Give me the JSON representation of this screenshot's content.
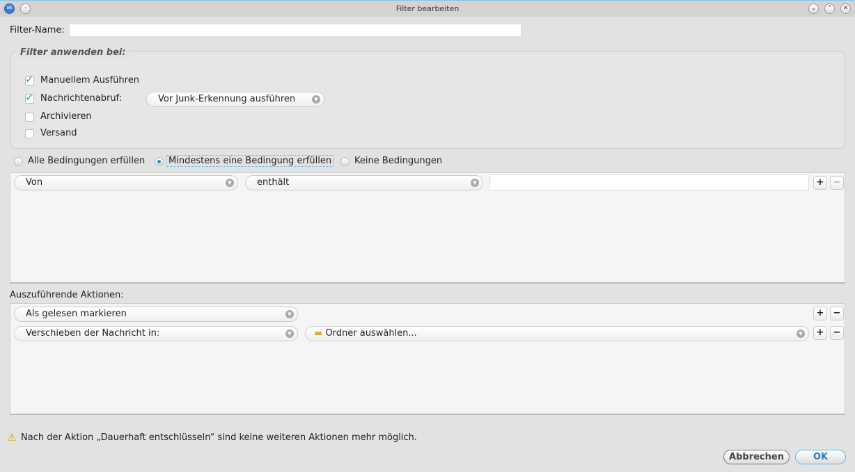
{
  "window": {
    "title": "Filter bearbeiten"
  },
  "filter_name": {
    "label": "Filter-Name:",
    "value": ""
  },
  "apply": {
    "legend": "Filter anwenden bei:",
    "items": [
      {
        "label": "Manuellem Ausführen",
        "checked": true
      },
      {
        "label": "Nachrichtenabruf:",
        "checked": true
      },
      {
        "label": "Archivieren",
        "checked": false
      },
      {
        "label": "Versand",
        "checked": false
      }
    ],
    "fetch_option": "Vor Junk-Erkennung ausführen"
  },
  "match": {
    "options": [
      "Alle Bedingungen erfüllen",
      "Mindestens eine Bedingung erfüllen",
      "Keine Bedingungen"
    ],
    "selected": 1
  },
  "conditions": [
    {
      "field": "Von",
      "operator": "enthält",
      "value": ""
    }
  ],
  "actions": {
    "label": "Auszuführende Aktionen:",
    "rows": [
      {
        "action": "Als gelesen markieren"
      },
      {
        "action": "Verschieben der Nachricht in:",
        "target": "Ordner auswählen..."
      }
    ]
  },
  "warning": "Nach der Aktion „Dauerhaft entschlüsseln“ sind keine weiteren Aktionen mehr möglich.",
  "buttons": {
    "cancel": "Abbrechen",
    "ok": "OK",
    "add": "+",
    "remove": "−"
  }
}
